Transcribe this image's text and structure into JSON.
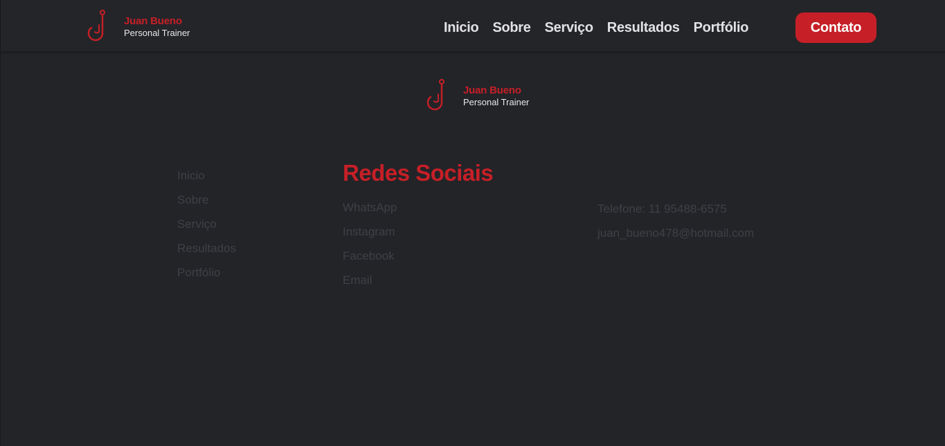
{
  "brand": {
    "name": "Juan Bueno",
    "tagline": "Personal Trainer",
    "accent_color": "#c71f27",
    "logo_icon": "stylized-j-logo"
  },
  "header": {
    "nav": [
      {
        "label": "Inicio"
      },
      {
        "label": "Sobre"
      },
      {
        "label": "Serviço"
      },
      {
        "label": "Resultados"
      },
      {
        "label": "Portfólio"
      }
    ],
    "cta_label": "Contato"
  },
  "footer": {
    "links": [
      {
        "label": "Inicio"
      },
      {
        "label": "Sobre"
      },
      {
        "label": "Serviço"
      },
      {
        "label": "Resultados"
      },
      {
        "label": "Portfólio"
      }
    ],
    "social": {
      "heading": "Redes Sociais",
      "items": [
        {
          "label": "WhatsApp"
        },
        {
          "label": "Instagram"
        },
        {
          "label": "Facebook"
        },
        {
          "label": "Email"
        }
      ]
    },
    "contact": {
      "phone": "Telefone: 11 95488-6575",
      "email": "juan_bueno478@hotmail.com"
    }
  }
}
